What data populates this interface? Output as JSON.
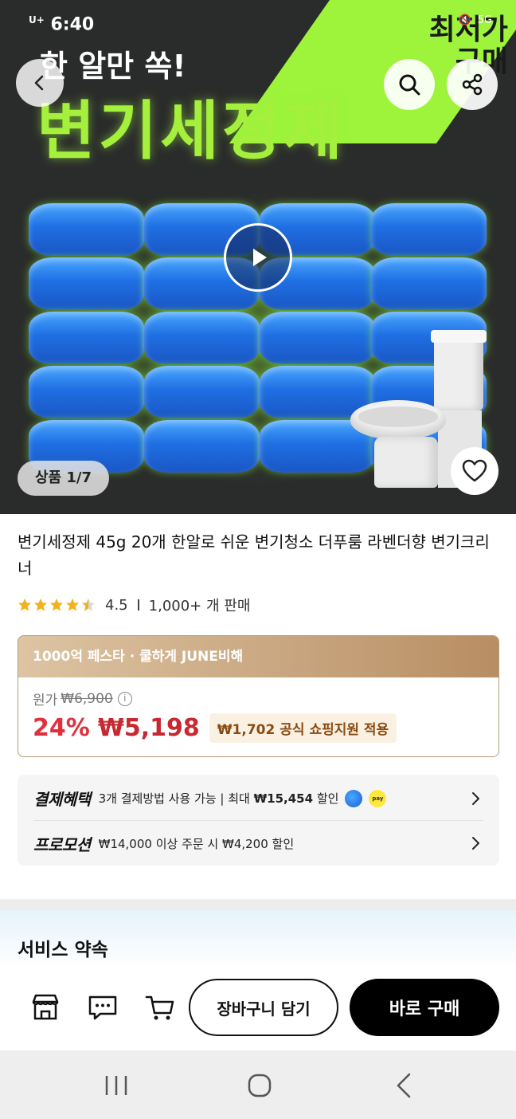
{
  "status_bar": {
    "carrier_time": "6:40",
    "carrier_mark": "U+",
    "network": "5G"
  },
  "hero": {
    "subtitle": "한 알만 쏙!",
    "title": "변기세정제",
    "corner_badge": "최저가 구매",
    "image_counter": "상품 1/7",
    "icons": [
      "back-arrow-icon",
      "search-icon",
      "share-icon",
      "play-icon",
      "heart-icon"
    ]
  },
  "product": {
    "title": "변기세정제 45g 20개 한알로 쉬운 변기청소 더푸룸 라벤더향 변기크리너",
    "rating": "4.5",
    "rating_stars": 4.5,
    "sales": "1,000+ 개 판매"
  },
  "price": {
    "banner": "1000억 페스타 · 쿨하게 JUNE비해",
    "original_label": "원가",
    "original_price": "₩6,900",
    "discount": "24%",
    "sale_price": "₩5,198",
    "support_tag": "₩1,702 공식 쇼핑지원 적용"
  },
  "benefits": {
    "payment_label": "결제혜택",
    "payment_text_a": "3개 결제방법 사용 가능 | 최대 ",
    "payment_text_b": "₩15,454",
    "payment_text_c": " 할인",
    "kakao_pay": "pay",
    "promotion_label": "프로모션",
    "promotion_text": "₩14,000 이상 주문 시 ₩4,200 할인"
  },
  "service": {
    "title": "서비스 약속"
  },
  "actions": {
    "cart_add": "장바구니 담기",
    "buy_now": "바로 구매",
    "icons": [
      "store-icon",
      "chat-icon",
      "cart-icon"
    ]
  },
  "colors": {
    "accent_green": "#a4f03c",
    "discount_red": "#e0303e",
    "price_red": "#c8282f",
    "banner_gold": "#b88e63",
    "buy_black": "#000000"
  }
}
